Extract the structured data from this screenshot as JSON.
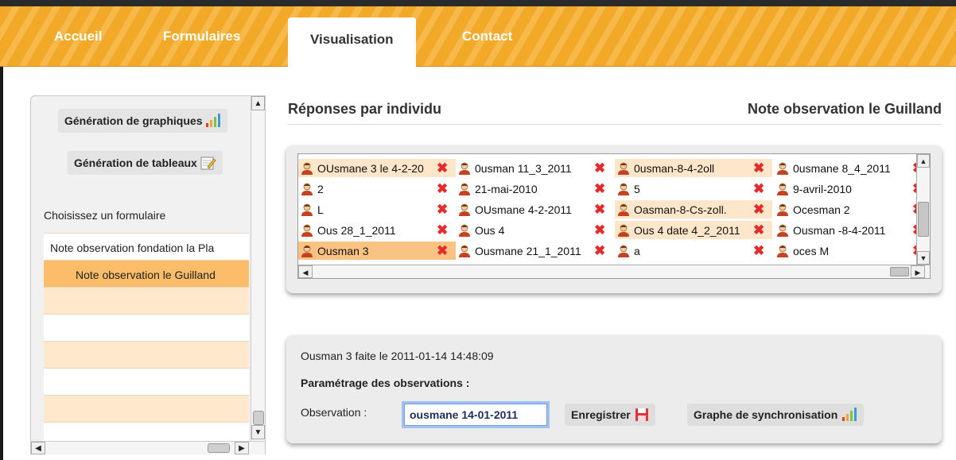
{
  "nav": {
    "tabs": [
      {
        "label": "Accueil"
      },
      {
        "label": "Formulaires"
      },
      {
        "label": "Visualisation"
      },
      {
        "label": "Contact"
      }
    ],
    "active": "Visualisation"
  },
  "sidebar": {
    "charts_button": "Génération de graphiques",
    "tables_button": "Génération de tableaux",
    "choose_label": "Choisissez un formulaire",
    "forms": [
      "Note observation fondation la Pla",
      "Note observation le Guilland"
    ],
    "selected_form": "Note observation le Guilland"
  },
  "main": {
    "title": "Réponses par individu",
    "form_title": "Note observation le Guilland"
  },
  "individuals": {
    "rows": [
      [
        "OUsmane 3 le 4-2-20",
        "0usman 11_3_2011",
        "0usman-8-4-2oll",
        "0usmane 8_4_2011"
      ],
      [
        "2",
        "21-mai-2010",
        "5",
        "9-avril-2010"
      ],
      [
        "L",
        "OUsmane 4-2-2011",
        "Oasman-8-Cs-zoll.",
        "Ocesman 2"
      ],
      [
        "Ous 28_1_2011",
        "Ous 4",
        "Ous 4 date 4_2_2011",
        "Ousman -8-4-2011"
      ],
      [
        "Ousman 3",
        "Ousmane 21_1_2011",
        "a",
        "oces M"
      ]
    ],
    "selected": "Ousman 3"
  },
  "detail": {
    "summary": "Ousman 3 faite le 2011-01-14 14:48:09",
    "heading": "Paramétrage des observations :",
    "observation_label": "Observation :",
    "observation_value": "ousmane 14-01-2011",
    "save_button": "Enregistrer",
    "sync_button": "Graphe de synchronisation"
  },
  "colors": {
    "nav_orange": "#f3a928",
    "row_highlight": "#fde6c9",
    "row_selected": "#fbc383",
    "delete_red": "#e42a2a"
  }
}
